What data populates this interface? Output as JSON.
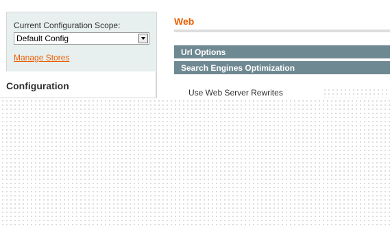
{
  "sidebar": {
    "scope_label": "Current Configuration Scope:",
    "scope_selected": "Default Config",
    "manage_stores_label": "Manage Stores",
    "configuration_title": "Configuration"
  },
  "main": {
    "page_title": "Web",
    "sections": [
      {
        "label": "Url Options"
      },
      {
        "label": "Search Engines Optimization"
      }
    ],
    "seo_fields": [
      {
        "label": "Use Web Server Rewrites"
      }
    ]
  },
  "colors": {
    "accent": "#eb5e00",
    "section_header_bg": "#6f8992",
    "scope_box_bg": "#e7efef"
  },
  "icons": {
    "select_arrow": "chevron-down-icon"
  }
}
